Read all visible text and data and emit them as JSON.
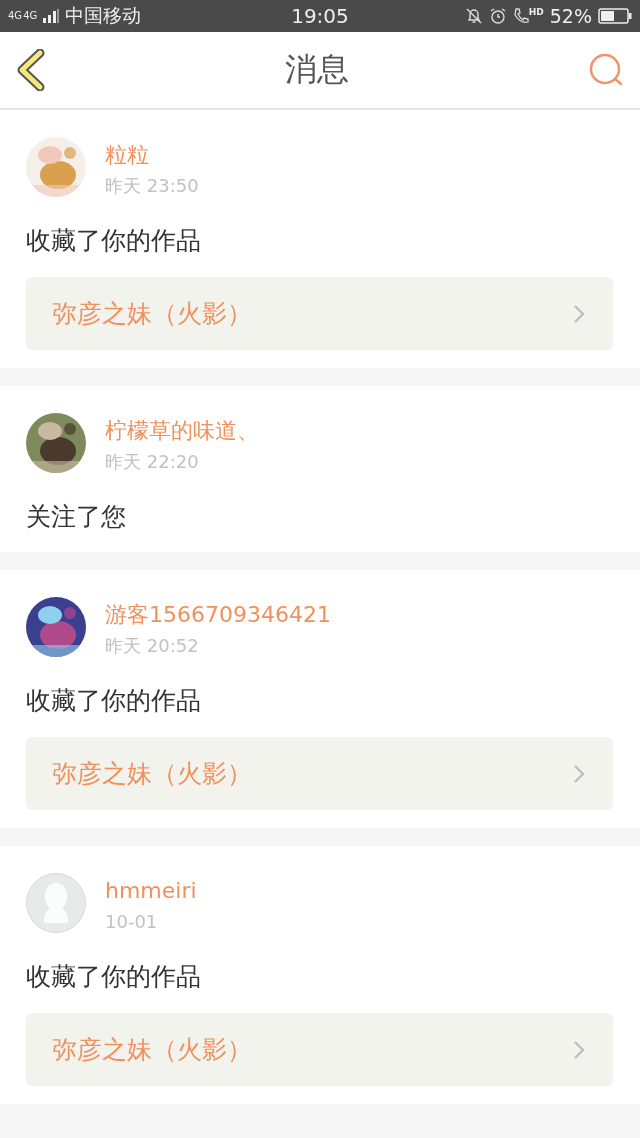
{
  "status_bar": {
    "network": [
      "4G",
      "4G"
    ],
    "carrier": "中国移动",
    "time": "19:05",
    "call_badge": "HD",
    "battery": "52%"
  },
  "header": {
    "title": "消息"
  },
  "messages": [
    {
      "name": "粒粒",
      "time": "昨天 23:50",
      "action": "收藏了你的作品",
      "work": "弥彦之妹（火影）"
    },
    {
      "name": "柠檬草的味道、",
      "time": "昨天 22:20",
      "action": "关注了您"
    },
    {
      "name": "游客1566709346421",
      "time": "昨天 20:52",
      "action": "收藏了你的作品",
      "work": "弥彦之妹（火影）"
    },
    {
      "avatar": {
        "kind": "default"
      },
      "name": "hmmeiri",
      "time": "10-01",
      "action": "收藏了你的作品",
      "work": "弥彦之妹（火影）"
    }
  ]
}
